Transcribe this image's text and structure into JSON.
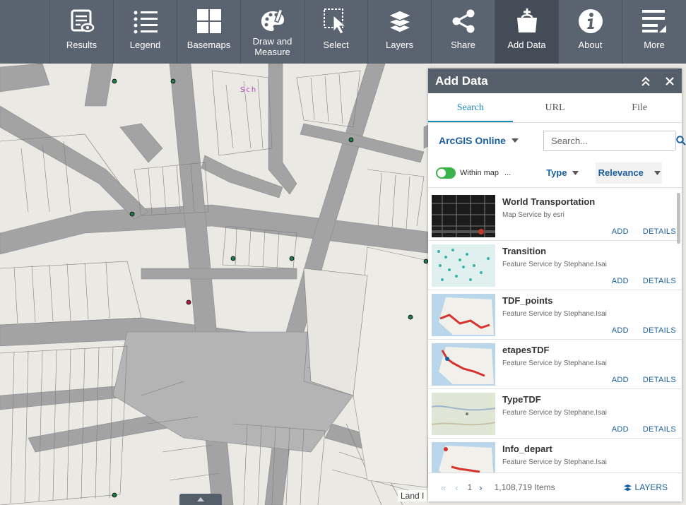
{
  "toolbar": {
    "items": [
      {
        "label": "Results",
        "icon": "results-icon"
      },
      {
        "label": "Legend",
        "icon": "legend-icon"
      },
      {
        "label": "Basemaps",
        "icon": "basemaps-icon"
      },
      {
        "label": "Draw and\nMeasure",
        "icon": "palette-icon"
      },
      {
        "label": "Select",
        "icon": "select-icon"
      },
      {
        "label": "Layers",
        "icon": "layers-icon"
      },
      {
        "label": "Share",
        "icon": "share-icon"
      },
      {
        "label": "Add Data",
        "icon": "add-data-icon"
      },
      {
        "label": "About",
        "icon": "info-icon"
      },
      {
        "label": "More",
        "icon": "more-icon"
      }
    ],
    "active": "Add Data",
    "colors": {
      "bar": "#5a6470",
      "active": "#434c57"
    }
  },
  "panel": {
    "title": "Add Data",
    "tabs": [
      "Search",
      "URL",
      "File"
    ],
    "active_tab": "Search",
    "source": "ArcGIS Online",
    "search_placeholder": "Search...",
    "within_map_label": "Within map",
    "within_map_more": "...",
    "within_map_on": true,
    "type_label": "Type",
    "sort_label": "Relevance",
    "results": [
      {
        "title": "World Transportation",
        "subtitle": "Map Service by esri"
      },
      {
        "title": "Transition",
        "subtitle": "Feature Service by Stephane.Isai"
      },
      {
        "title": "TDF_points",
        "subtitle": "Feature Service by Stephane.Isai"
      },
      {
        "title": "etapesTDF",
        "subtitle": "Feature Service by Stephane.Isai"
      },
      {
        "title": "TypeTDF",
        "subtitle": "Feature Service by Stephane.Isai"
      },
      {
        "title": "Info_depart",
        "subtitle": "Feature Service by Stephane.Isai"
      }
    ],
    "add_label": "ADD",
    "details_label": "DETAILS",
    "page": "1",
    "item_count": "1,108,719 Items",
    "layers_label": "LAYERS",
    "accent": "#1a89b8",
    "link": "#1a5fa0"
  },
  "map": {
    "label": "Sch",
    "attribution": "Land I"
  }
}
